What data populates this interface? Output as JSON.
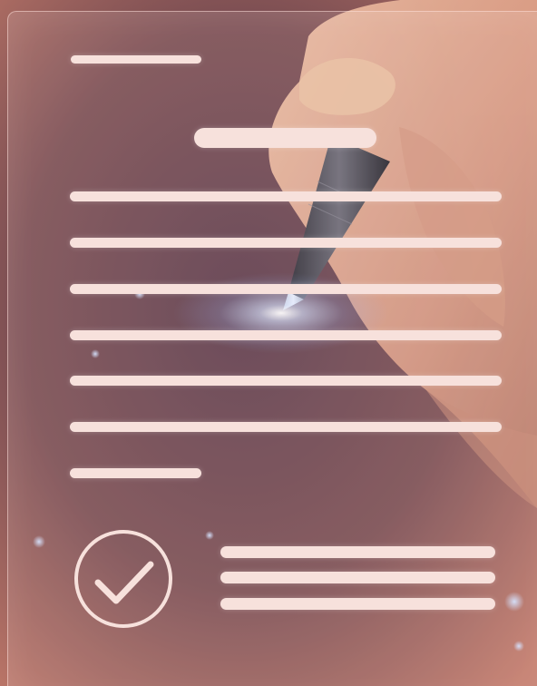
{
  "image": {
    "description_icons": {
      "check": "checkmark-circle-icon",
      "pen": "pen-icon"
    },
    "colors": {
      "background_warm": "#c9776a",
      "background_dark": "#4a2f3d",
      "line_color": "#f7e1dc",
      "skin": "#e9b39a"
    }
  }
}
